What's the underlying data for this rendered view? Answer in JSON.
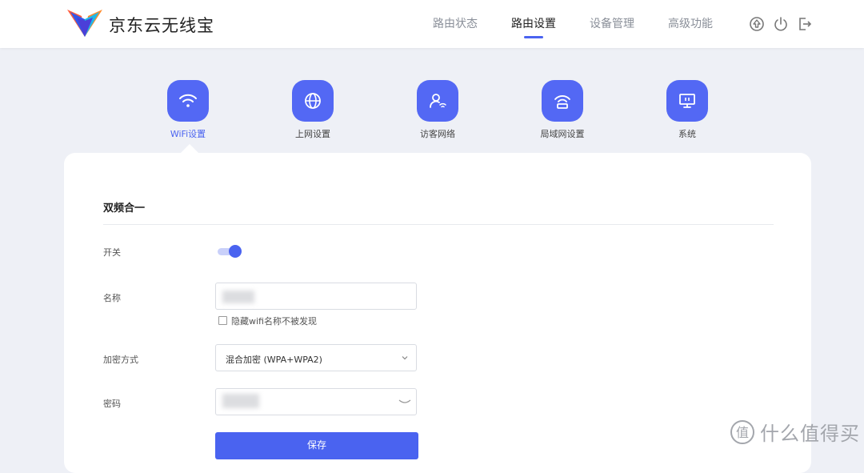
{
  "header": {
    "brand": "京东云无线宝",
    "nav": [
      "路由状态",
      "路由设置",
      "设备管理",
      "高级功能"
    ],
    "active_nav": "路由设置",
    "icons": [
      "upgrade-icon",
      "power-icon",
      "logout-icon"
    ]
  },
  "tabs": [
    {
      "label": "WiFi设置",
      "icon": "wifi-icon",
      "active": true
    },
    {
      "label": "上网设置",
      "icon": "globe-icon",
      "active": false
    },
    {
      "label": "访客网络",
      "icon": "guest-icon",
      "active": false
    },
    {
      "label": "局域网设置",
      "icon": "router-icon",
      "active": false
    },
    {
      "label": "系统",
      "icon": "monitor-icon",
      "active": false
    }
  ],
  "form": {
    "section_title": "双频合一",
    "switch_label": "开关",
    "switch_on": true,
    "name_label": "名称",
    "name_value": "",
    "hide_label": "隐藏wifi名称不被发现",
    "hide_checked": false,
    "encryption_label": "加密方式",
    "encryption_value": "混合加密 (WPA+WPA2)",
    "password_label": "密码",
    "password_value": "",
    "save_label": "保存"
  },
  "watermark": {
    "text": "什么值得买",
    "glyph": "值"
  },
  "colors": {
    "accent": "#4a63f0",
    "background": "#eef0f6"
  }
}
